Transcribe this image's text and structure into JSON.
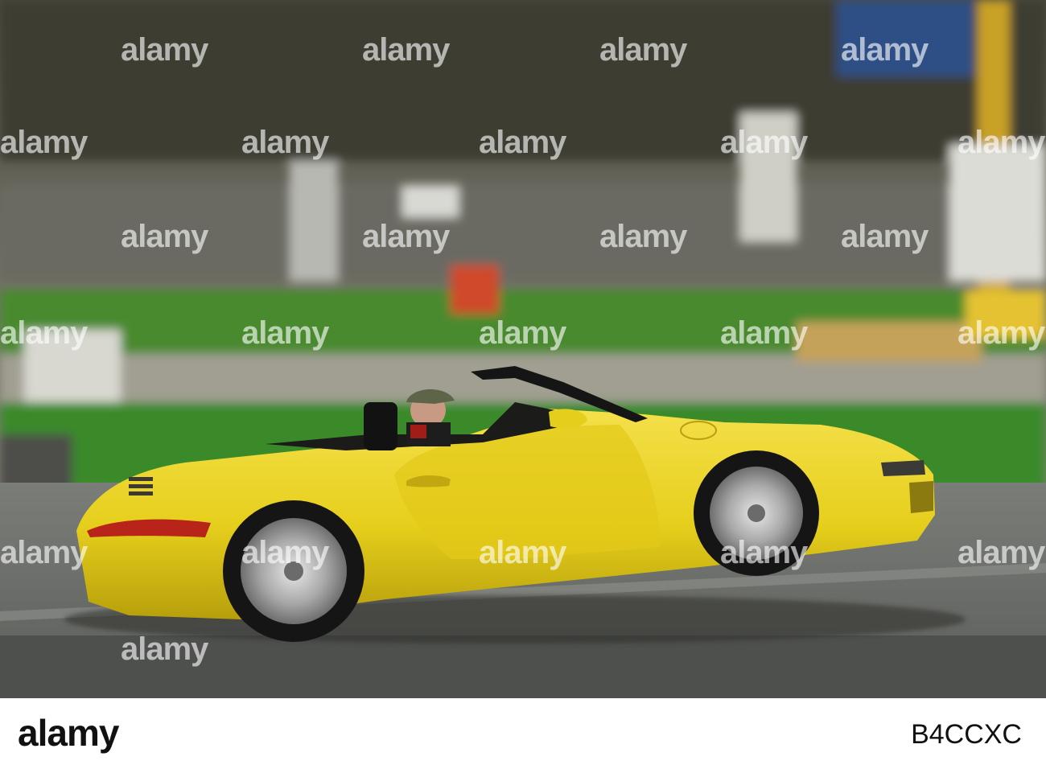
{
  "watermark": {
    "text": "alamy",
    "marks": [
      "alamy",
      "alamy",
      "alamy",
      "alamy",
      "alamy",
      "alamy",
      "alamy",
      "alamy",
      "alamy",
      "alamy",
      "alamy",
      "alamy",
      "alamy",
      "alamy",
      "alamy",
      "alamy",
      "alamy",
      "alamy",
      "alamy",
      "alamy",
      "alamy",
      "alamy",
      "alamy",
      "alamy"
    ]
  },
  "footer": {
    "brand": "alamy",
    "stock_id": "B4CCXC"
  },
  "colors": {
    "car_body": "#e9d21e",
    "road": "#6d6f6b",
    "grass": "#4a8a2e"
  }
}
